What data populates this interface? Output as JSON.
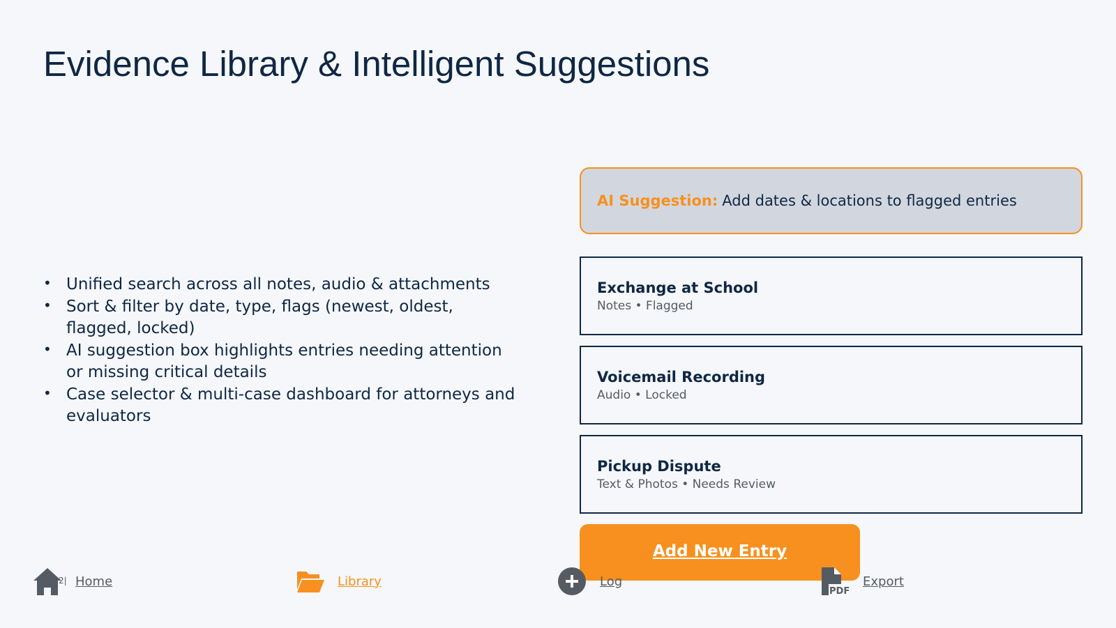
{
  "header": {
    "title": "Evidence Library & Intelligent Suggestions"
  },
  "features": [
    "Unified search across all notes, audio & attachments",
    "Sort & filter by date, type, flags (newest, oldest, flagged, locked)",
    "AI suggestion box highlights entries needing attention or missing critical details",
    "Case selector & multi‑case dashboard for attorneys and evaluators"
  ],
  "ai_suggestion": {
    "label": "AI Suggestion:",
    "text": "Add dates & locations to flagged entries"
  },
  "entries": [
    {
      "title": "Exchange at School",
      "meta": "Notes • Flagged"
    },
    {
      "title": "Voicemail Recording",
      "meta": "Audio • Locked"
    },
    {
      "title": "Pickup Dispute",
      "meta": "Text & Photos • Needs Review"
    }
  ],
  "add_button": {
    "label": "Add New Entry"
  },
  "nav": {
    "home": {
      "label": "Home",
      "icon": "home-icon"
    },
    "library": {
      "label": "Library",
      "icon": "folder-open-icon"
    },
    "log": {
      "label": "Log",
      "icon": "plus-circle-icon"
    },
    "export": {
      "label": "Export",
      "icon": "pdf-file-icon"
    },
    "home_badge": "2|"
  },
  "colors": {
    "accent": "#f7901e",
    "navy": "#0f2744",
    "background": "#f5f7fa",
    "suggestion_bg": "#d2d7df",
    "muted": "#555b63"
  }
}
